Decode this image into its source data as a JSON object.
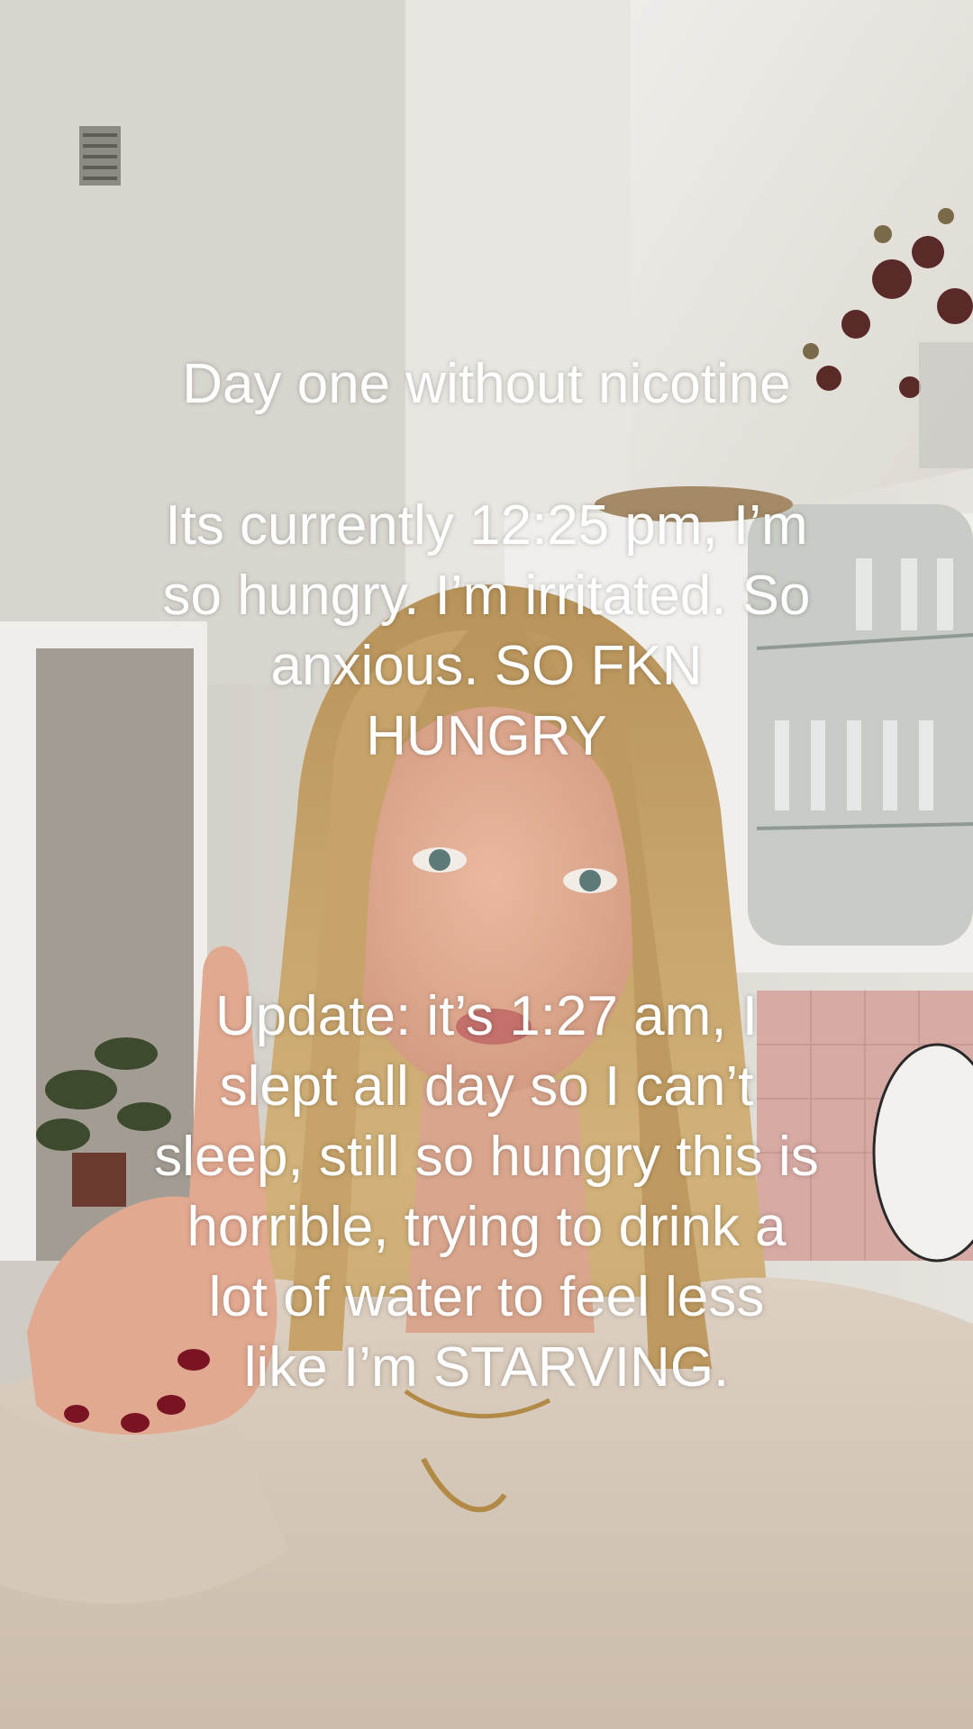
{
  "caption": {
    "title": "Day one without nicotine",
    "entry_one": "Its currently 12:25 pm, I’m\nso hungry. I’m irritated. So\nanxious. SO FKN\nHUNGRY",
    "entry_two": "Update: it’s 1:27 am, I\nslept all day so I can’t\nsleep, still so hungry this is\nhorrible, trying to drink a\nlot of water to feel less\nlike I’m STARVING."
  },
  "colors": {
    "caption_text": "#ffffff",
    "wall": "#e3e0da",
    "hair": "#c9a871",
    "sweater": "#d9cbbd",
    "nail_polish": "#7a1424"
  }
}
